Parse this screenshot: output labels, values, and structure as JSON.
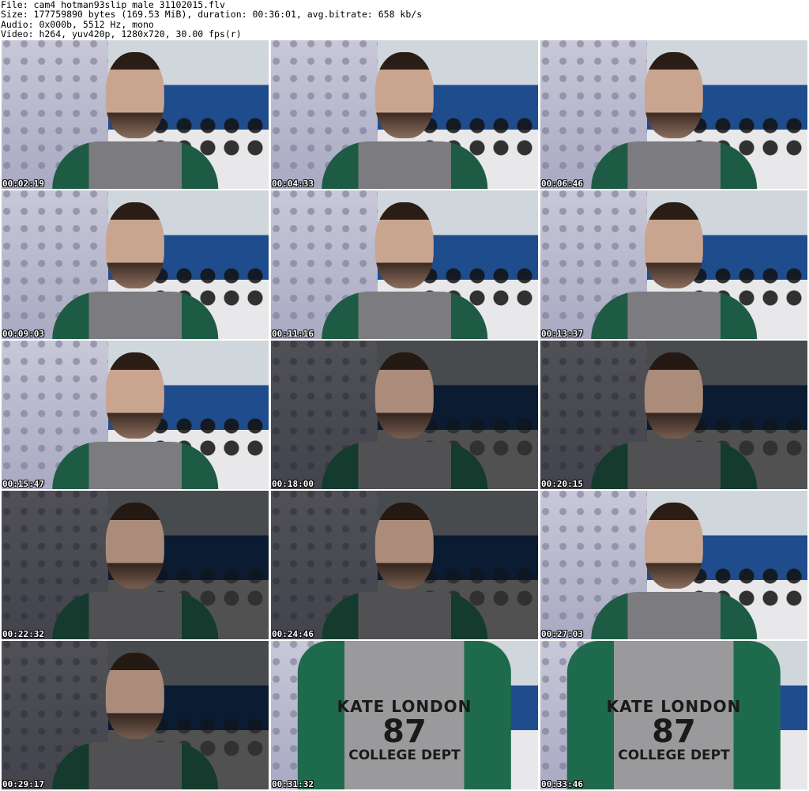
{
  "header": {
    "file": "File: cam4_hotman93slip_male_31102015.flv",
    "size": "Size: 177759890 bytes (169.53 MiB), duration: 00:36:01, avg.bitrate: 658 kb/s",
    "audio": "Audio: 0x000b, 5512 Hz, mono",
    "video": "Video: h264, yuv420p, 1280x720, 30.00 fps(r)"
  },
  "thumbnails": [
    {
      "timestamp": "00:02:19"
    },
    {
      "timestamp": "00:04:33"
    },
    {
      "timestamp": "00:06:46"
    },
    {
      "timestamp": "00:09:03"
    },
    {
      "timestamp": "00:11:16"
    },
    {
      "timestamp": "00:13:37"
    },
    {
      "timestamp": "00:15:47"
    },
    {
      "timestamp": "00:18:00"
    },
    {
      "timestamp": "00:20:15"
    },
    {
      "timestamp": "00:22:32"
    },
    {
      "timestamp": "00:24:46"
    },
    {
      "timestamp": "00:27:03"
    },
    {
      "timestamp": "00:29:17"
    },
    {
      "timestamp": "00:31:32",
      "shirt": {
        "line1": "KATE LONDON",
        "line2": "87",
        "line3": "COLLEGE DEPT"
      }
    },
    {
      "timestamp": "00:33:46",
      "shirt": {
        "line1": "KATE LONDON",
        "line2": "87",
        "line3": "COLLEGE DEPT"
      }
    }
  ]
}
